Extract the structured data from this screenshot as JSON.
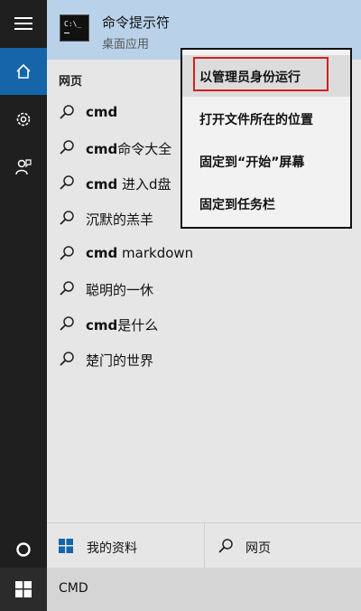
{
  "best_match": {
    "title": "命令提示符",
    "subtitle": "桌面应用",
    "icon_text": "C:\\_"
  },
  "web_section": {
    "header": "网页",
    "suggestions": [
      {
        "bold": "cmd",
        "rest": ""
      },
      {
        "bold": "cmd",
        "rest": "命令大全"
      },
      {
        "bold": "cmd",
        "rest": " 进入d盘"
      },
      {
        "bold": "",
        "rest": "沉默的羔羊"
      },
      {
        "bold": "cmd",
        "rest": " markdown"
      },
      {
        "bold": "",
        "rest": "聪明的一休"
      },
      {
        "bold": "cmd",
        "rest": "是什么"
      },
      {
        "bold": "",
        "rest": "楚门的世界"
      }
    ]
  },
  "context_menu": {
    "items": [
      "以管理员身份运行",
      "打开文件所在的位置",
      "固定到“开始”屏幕",
      "固定到任务栏"
    ]
  },
  "bottom": {
    "my_stuff": "我的资料",
    "web": "网页"
  },
  "search": {
    "query": "CMD"
  },
  "colors": {
    "accent": "#1565a8",
    "rail": "#1f1f1f",
    "selection": "#b9d2ea",
    "highlight_border": "#d32020"
  }
}
